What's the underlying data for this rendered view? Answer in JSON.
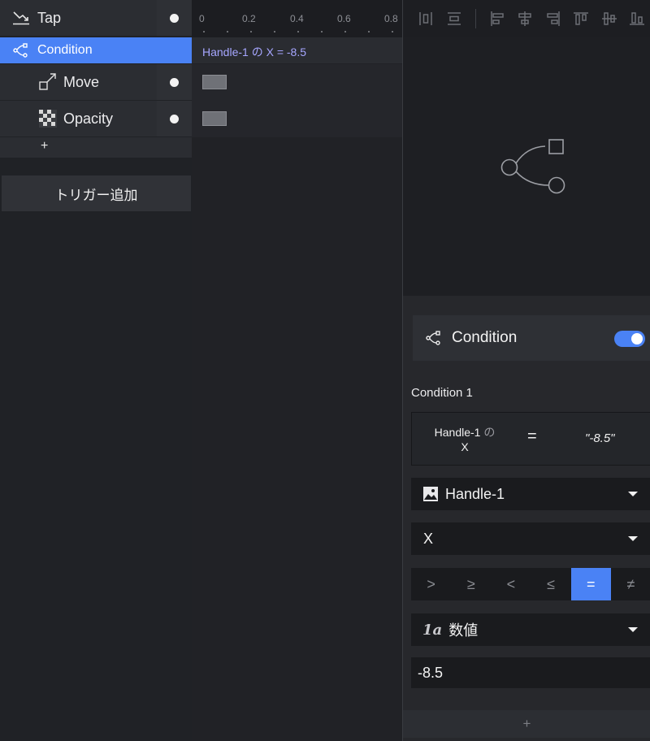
{
  "triggers": {
    "tap_label": "Tap",
    "condition_label": "Condition",
    "responses": [
      {
        "label": "Move"
      },
      {
        "label": "Opacity"
      }
    ],
    "add_response_label": "+",
    "add_trigger_label": "トリガー追加"
  },
  "timeline": {
    "ticks": [
      "0",
      "0.2",
      "0.4",
      "0.6",
      "0.8"
    ],
    "condition_summary": "Handle-1 の X = -8.5"
  },
  "inspector": {
    "card_title": "Condition",
    "toggle_on": true,
    "section_title": "Condition 1",
    "summary": {
      "target": "Handle-1",
      "of": "の",
      "property": "X",
      "operator": "=",
      "value": "\"-8.5\""
    },
    "target_layer": "Handle-1",
    "property": "X",
    "operators": [
      ">",
      "≥",
      "<",
      "≤",
      "=",
      "≠"
    ],
    "selected_operator": "=",
    "value_type_glyph": "1a",
    "value_type": "数値",
    "value": "-8.5",
    "add_label": "+"
  },
  "colors": {
    "accent": "#4a82f5",
    "panel": "#2b2d32",
    "background": "#1e1f23"
  },
  "icons": {
    "tap": "tap-icon",
    "condition": "condition-icon",
    "move": "move-icon",
    "opacity": "opacity-icon",
    "layer": "image-icon",
    "value_type": "number-type-icon"
  }
}
